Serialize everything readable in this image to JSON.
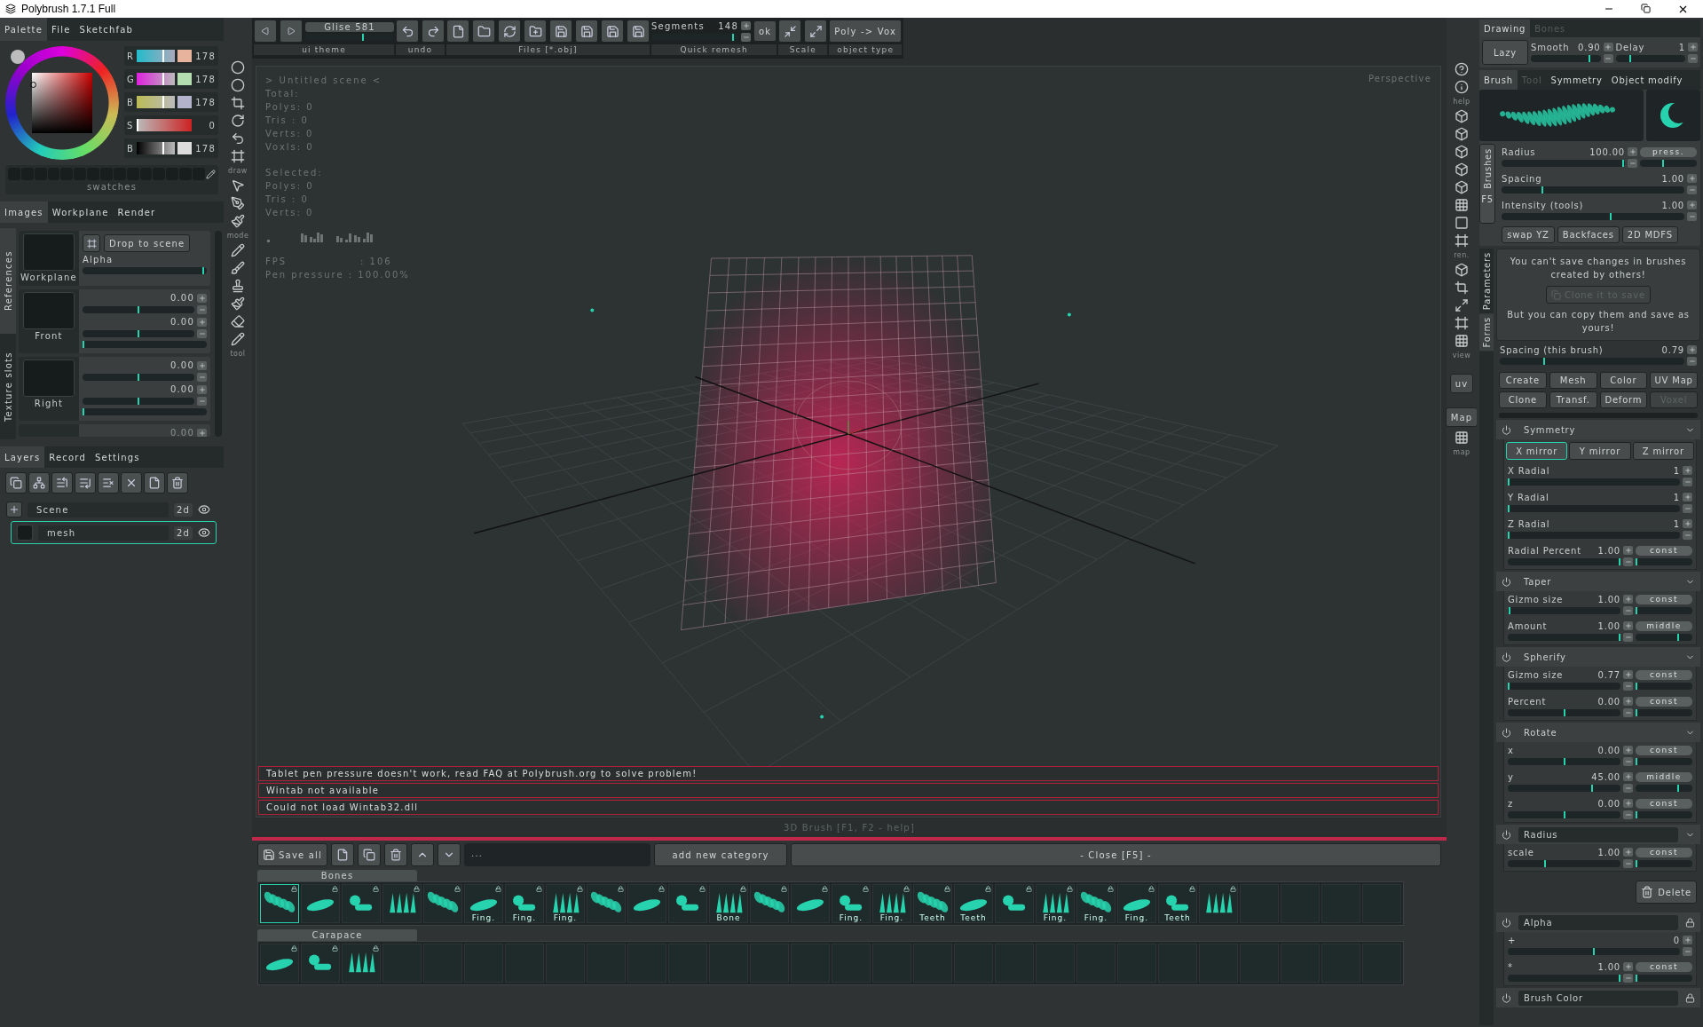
{
  "window": {
    "title": "Polybrush 1.7.1 Full"
  },
  "palette": {
    "tabs": [
      {
        "label": "Palette",
        "selected": true
      },
      {
        "label": "File",
        "selected": false
      },
      {
        "label": "Sketchfab",
        "selected": false
      }
    ],
    "channels": [
      {
        "label": "R",
        "value": "178",
        "level": 0.7
      },
      {
        "label": "G",
        "value": "178",
        "level": 0.7
      },
      {
        "label": "B",
        "value": "178",
        "level": 0.7
      },
      {
        "label": "S",
        "value": "0",
        "level": 0
      },
      {
        "label": "B",
        "value": "178",
        "level": 0.7
      }
    ],
    "swatches_label": "swatches"
  },
  "images": {
    "tabs": [
      {
        "label": "Images",
        "selected": true
      },
      {
        "label": "Workplane",
        "selected": false
      },
      {
        "label": "Render",
        "selected": false
      }
    ],
    "side_tabs": [
      {
        "label": "References",
        "selected": true
      },
      {
        "label": "Texture slots",
        "selected": false
      }
    ],
    "workplane": {
      "name": "Workplane",
      "drop_button": "Drop to scene",
      "alpha_label": "Alpha",
      "level": 0.98
    },
    "slots": [
      {
        "name": "Front",
        "values": [
          {
            "value": "0.00",
            "level": 0.5
          },
          {
            "value": "0.00",
            "level": 0.5
          }
        ],
        "level": 0
      },
      {
        "name": "Right",
        "values": [
          {
            "value": "0.00",
            "level": 0.5
          },
          {
            "value": "0.00",
            "level": 0.5
          }
        ],
        "level": 0
      }
    ],
    "cut_value": "0.00"
  },
  "layers": {
    "tabs": [
      {
        "label": "Layers",
        "selected": true
      },
      {
        "label": "Record",
        "selected": false
      },
      {
        "label": "Settings",
        "selected": false
      }
    ],
    "items": [
      {
        "name": "Scene",
        "badge": "2d",
        "selected": false,
        "visible": true
      },
      {
        "name": "mesh",
        "badge": "2d",
        "selected": true,
        "visible": true
      }
    ]
  },
  "tool_strip": {
    "captions": [
      "draw",
      "mode",
      "tool"
    ]
  },
  "toolbar": {
    "theme": {
      "name": "Glise 581",
      "level": 0.65,
      "caption": "ui theme"
    },
    "undo_caption": "undo",
    "files_caption": "Files [*.obj]",
    "remesh": {
      "label": "Segments",
      "value": "148",
      "level": 0.95,
      "ok": "ok",
      "caption": "Quick remesh"
    },
    "scale_caption": "Scale",
    "object_type": {
      "button": "Poly -> Vox",
      "caption": "object type"
    }
  },
  "viewport": {
    "label": "Perspective",
    "stats": [
      [
        "> Untitled scene <",
        "Total:",
        "Polys: 0",
        "Tris : 0",
        "Verts: 0",
        "Voxls: 0"
      ],
      [
        "Selected:",
        "Polys: 0",
        "Tris : 0",
        "Verts: 0"
      ],
      [
        "FPS                : 106",
        "Pen pressure : 100.00%"
      ]
    ],
    "messages": [
      "Tablet pen pressure doesn't work, read FAQ at Polybrush.org to solve problem!",
      "Wintab not available",
      "Could not load Wintab32.dll"
    ]
  },
  "brush_hint": "3D Brush  [F1, F2 - help]",
  "library": {
    "save_all": "Save all",
    "search_value": "...",
    "add_category": "add new category",
    "close": "- Close [F5] -",
    "categories": [
      {
        "name": "Bones",
        "items": [
          {
            "kind": "brush",
            "selected": true
          },
          {
            "kind": "brush",
            "selected": false
          },
          {
            "kind": "brush",
            "selected": false
          },
          {
            "kind": "brush",
            "selected": false
          },
          {
            "kind": "brush",
            "selected": false
          },
          {
            "kind": "brush",
            "selected": false,
            "label": "Fing."
          },
          {
            "kind": "brush",
            "selected": false,
            "label": "Fing."
          },
          {
            "kind": "brush",
            "selected": false,
            "label": "Fing."
          },
          {
            "kind": "brush",
            "selected": false
          },
          {
            "kind": "brush",
            "selected": false
          },
          {
            "kind": "brush",
            "selected": false
          },
          {
            "kind": "brush",
            "selected": false,
            "label": "Bone"
          },
          {
            "kind": "brush",
            "selected": false
          },
          {
            "kind": "brush",
            "selected": false
          },
          {
            "kind": "brush",
            "selected": false,
            "label": "Fing."
          },
          {
            "kind": "brush",
            "selected": false,
            "label": "Fing."
          },
          {
            "kind": "brush",
            "selected": false,
            "label": "Teeth"
          },
          {
            "kind": "brush",
            "selected": false,
            "label": "Teeth"
          },
          {
            "kind": "brush",
            "selected": false
          },
          {
            "kind": "brush",
            "selected": false,
            "label": "Fing."
          },
          {
            "kind": "brush",
            "selected": false,
            "label": "Fing."
          },
          {
            "kind": "brush",
            "selected": false,
            "label": "Fing."
          },
          {
            "kind": "brush",
            "selected": false,
            "label": "Teeth"
          },
          {
            "kind": "brush",
            "selected": false
          },
          {
            "kind": "empty"
          },
          {
            "kind": "empty"
          },
          {
            "kind": "empty"
          },
          {
            "kind": "empty"
          }
        ]
      },
      {
        "name": "Carapace",
        "items": [
          {
            "kind": "brush",
            "selected": false
          },
          {
            "kind": "brush",
            "selected": false
          },
          {
            "kind": "brush",
            "selected": false
          },
          {
            "kind": "empty"
          },
          {
            "kind": "empty"
          },
          {
            "kind": "empty"
          },
          {
            "kind": "empty"
          },
          {
            "kind": "empty"
          },
          {
            "kind": "empty"
          },
          {
            "kind": "empty"
          },
          {
            "kind": "empty"
          },
          {
            "kind": "empty"
          },
          {
            "kind": "empty"
          },
          {
            "kind": "empty"
          },
          {
            "kind": "empty"
          },
          {
            "kind": "empty"
          },
          {
            "kind": "empty"
          },
          {
            "kind": "empty"
          },
          {
            "kind": "empty"
          },
          {
            "kind": "empty"
          },
          {
            "kind": "empty"
          },
          {
            "kind": "empty"
          },
          {
            "kind": "empty"
          },
          {
            "kind": "empty"
          },
          {
            "kind": "empty"
          },
          {
            "kind": "empty"
          },
          {
            "kind": "empty"
          },
          {
            "kind": "empty"
          }
        ]
      }
    ]
  },
  "side_strip": {
    "captions": [
      "help",
      "ren.",
      "view",
      "uv",
      "Map",
      "map"
    ]
  },
  "drawing": {
    "tabs": [
      {
        "label": "Drawing",
        "selected": true,
        "disabled": false
      },
      {
        "label": "Bones",
        "selected": false,
        "disabled": true
      }
    ],
    "lazy": "Lazy",
    "smooth": {
      "label": "Smooth",
      "value": "0.90",
      "level": 0.85
    },
    "delay": {
      "label": "Delay",
      "value": "1",
      "level": 0.2
    }
  },
  "brush": {
    "tabs": [
      {
        "label": "Brush",
        "selected": true,
        "disabled": false
      },
      {
        "label": "Tool",
        "selected": false,
        "disabled": true
      },
      {
        "label": "Symmetry",
        "selected": false,
        "disabled": false
      },
      {
        "label": "Object modify",
        "selected": false,
        "disabled": false
      }
    ],
    "brushes_tab": "Brushes",
    "brushes_key": "F5",
    "params": [
      {
        "label": "Radius",
        "value": "100.00",
        "level": 0.99,
        "mode": {
          "label": "press.",
          "level": 0.4
        }
      },
      {
        "label": "Spacing",
        "value": "1.00",
        "level": 0.22
      },
      {
        "label": "Intensity (tools)",
        "value": "1.00",
        "level": 0.6
      }
    ],
    "buttons": [
      "swap YZ",
      "Backfaces",
      "2D MDFS"
    ]
  },
  "forms": {
    "side_tabs": [
      {
        "label": "Parameters",
        "selected": false
      },
      {
        "label": "Forms",
        "selected": true
      }
    ],
    "notice_top": "You can't save changes in brushes created by others!",
    "clone_button": "Clone it to save",
    "notice_bottom": "But you can copy them and save as yours!",
    "spacing": {
      "label": "Spacing (this brush)",
      "value": "0.79",
      "level": 0.24
    },
    "buttons": [
      {
        "label": "Create",
        "disabled": false
      },
      {
        "label": "Mesh",
        "disabled": false
      },
      {
        "label": "Color",
        "disabled": false
      },
      {
        "label": "UV Map",
        "disabled": false
      },
      {
        "label": "Clone",
        "disabled": false
      },
      {
        "label": "Transf.",
        "disabled": false
      },
      {
        "label": "Deform",
        "disabled": false
      },
      {
        "label": "Voxel",
        "disabled": true
      }
    ],
    "sections": [
      {
        "title": "Symmetry",
        "locked": false,
        "boxed": false,
        "mirrors": [
          {
            "label": "X mirror",
            "selected": true
          },
          {
            "label": "Y mirror",
            "selected": false
          },
          {
            "label": "Z mirror",
            "selected": false
          }
        ],
        "params": [
          {
            "label": "X Radial",
            "value": "1",
            "level": 0
          },
          {
            "label": "Y Radial",
            "value": "1",
            "level": 0
          },
          {
            "label": "Z Radial",
            "value": "1",
            "level": 0
          },
          {
            "label": "Radial Percent",
            "value": "1.00",
            "level": 1,
            "mode": {
              "label": "const",
              "level": 0
            }
          }
        ]
      },
      {
        "title": "Taper",
        "locked": false,
        "boxed": false,
        "params": [
          {
            "label": "Gizmo size",
            "value": "1.00",
            "level": 0.01,
            "mode": {
              "label": "const",
              "level": 0
            }
          },
          {
            "label": "Amount",
            "value": "1.00",
            "level": 1,
            "mode": {
              "label": "middle",
              "level": 0.75
            }
          }
        ]
      },
      {
        "title": "Spherify",
        "locked": false,
        "boxed": false,
        "params": [
          {
            "label": "Gizmo size",
            "value": "0.77",
            "level": 0,
            "mode": {
              "label": "const",
              "level": 0
            }
          },
          {
            "label": "Percent",
            "value": "0.00",
            "level": 0.5,
            "mode": {
              "label": "const",
              "level": 0
            }
          }
        ]
      },
      {
        "title": "Rotate",
        "locked": false,
        "boxed": false,
        "params": [
          {
            "label": "x",
            "value": "0.00",
            "level": 0.5,
            "mode": {
              "label": "const",
              "level": 0
            }
          },
          {
            "label": "y",
            "value": "45.00",
            "level": 0.75,
            "mode": {
              "label": "middle",
              "level": 0.75
            }
          },
          {
            "label": "z",
            "value": "0.00",
            "level": 0.5,
            "mode": {
              "label": "const",
              "level": 0
            }
          }
        ]
      },
      {
        "title": "Radius",
        "locked": false,
        "boxed": true,
        "params": [
          {
            "label": "scale",
            "value": "1.00",
            "level": 0.33,
            "mode": {
              "label": "const",
              "level": 0
            }
          }
        ]
      }
    ],
    "delete": "Delete",
    "locked_sections": [
      {
        "title": "Alpha",
        "locked": true,
        "boxed": true,
        "params": [
          {
            "label": "+",
            "value": "0",
            "level": 0.5
          },
          {
            "label": "*",
            "value": "1.00",
            "level": 1,
            "mode": {
              "label": "const",
              "level": 0
            }
          }
        ]
      },
      {
        "title": "Brush Color",
        "locked": true,
        "boxed": true
      }
    ]
  }
}
